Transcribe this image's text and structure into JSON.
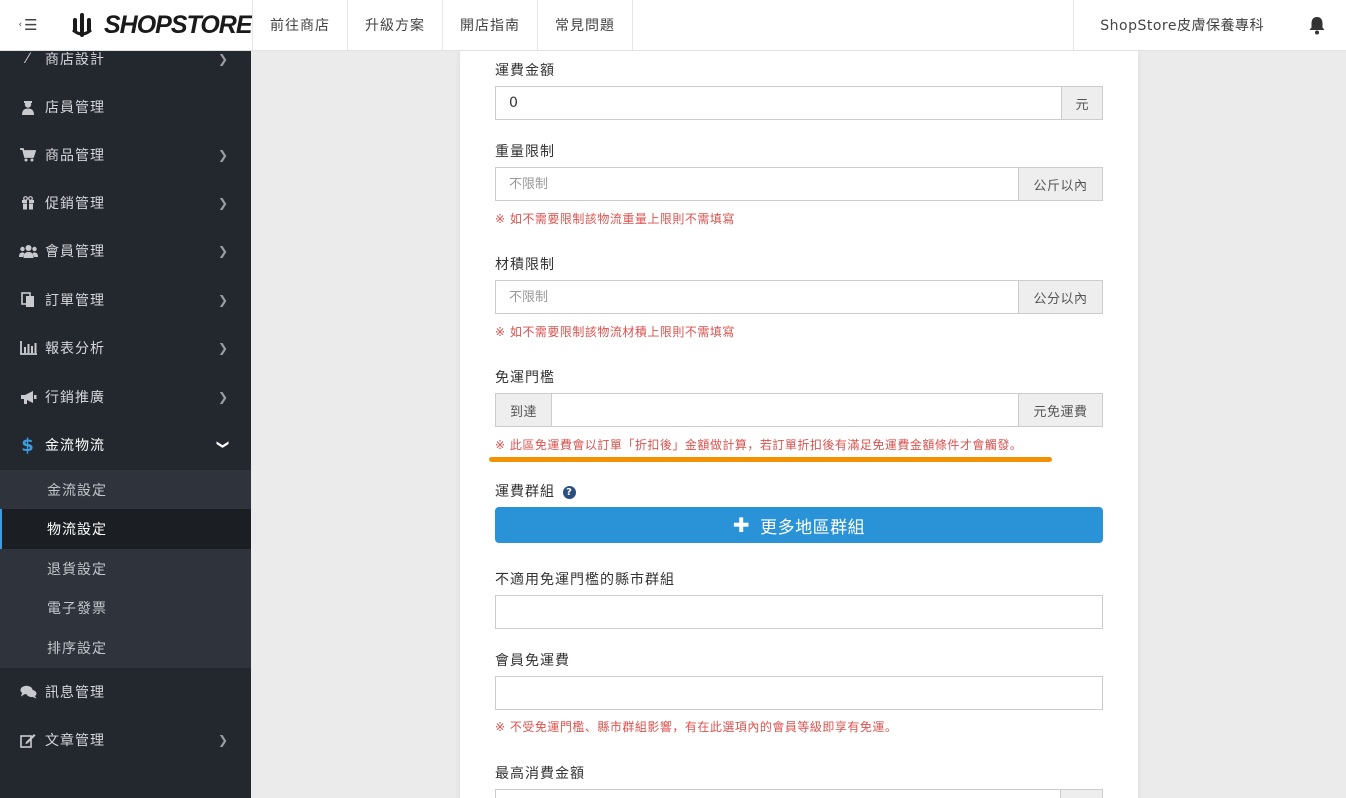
{
  "topbar": {
    "toggle_icon": "menu-toggle-icon",
    "logo_text": "SHOPSTORE",
    "nav": [
      "前往商店",
      "升級方案",
      "開店指南",
      "常見問題"
    ],
    "store_name": "ShopStore皮膚保養專科",
    "bell_icon": "bell-icon"
  },
  "sidebar": {
    "items": [
      {
        "label": "商店設計",
        "icon": "wand-icon"
      },
      {
        "label": "店員管理",
        "icon": "user-secret-icon"
      },
      {
        "label": "商品管理",
        "icon": "cart-icon"
      },
      {
        "label": "促銷管理",
        "icon": "gift-icon"
      },
      {
        "label": "會員管理",
        "icon": "users-icon"
      },
      {
        "label": "訂單管理",
        "icon": "copy-icon"
      },
      {
        "label": "報表分析",
        "icon": "bar-chart-icon"
      },
      {
        "label": "行銷推廣",
        "icon": "bullhorn-icon"
      },
      {
        "label": "金流物流",
        "icon": "dollar-icon"
      },
      {
        "label": "訊息管理",
        "icon": "comments-icon"
      },
      {
        "label": "文章管理",
        "icon": "edit-icon"
      }
    ],
    "subitems": [
      "金流設定",
      "物流設定",
      "退貨設定",
      "電子發票",
      "排序設定"
    ],
    "accent_color": "#3b9de0"
  },
  "form": {
    "shipping_fee": {
      "label": "運費金額",
      "value": "0",
      "addon": "元"
    },
    "weight_limit": {
      "label": "重量限制",
      "placeholder": "不限制",
      "addon": "公斤以內",
      "hint": "※ 如不需要限制該物流重量上限則不需填寫"
    },
    "volume_limit": {
      "label": "材積限制",
      "placeholder": "不限制",
      "addon": "公分以內",
      "hint": "※ 如不需要限制該物流材積上限則不需填寫"
    },
    "free_threshold": {
      "label": "免運門檻",
      "prefix": "到達",
      "addon": "元免運費",
      "hint": "※ 此區免運費會以訂單「折扣後」金額做計算，若訂單折扣後有滿足免運費金額條件才會觸發。"
    },
    "shipping_group": {
      "label": "運費群組",
      "button_label": "更多地區群組"
    },
    "excluded_counties": {
      "label": "不適用免運門檻的縣市群組"
    },
    "member_free": {
      "label": "會員免運費",
      "hint": "※ 不受免運門檻、縣市群組影響，有在此選項內的會員等級即享有免運。"
    },
    "max_amount": {
      "label": "最高消費金額"
    },
    "highlight_color": "#f39200",
    "button_color": "#2a93d8",
    "hint_color": "#d9534f"
  }
}
